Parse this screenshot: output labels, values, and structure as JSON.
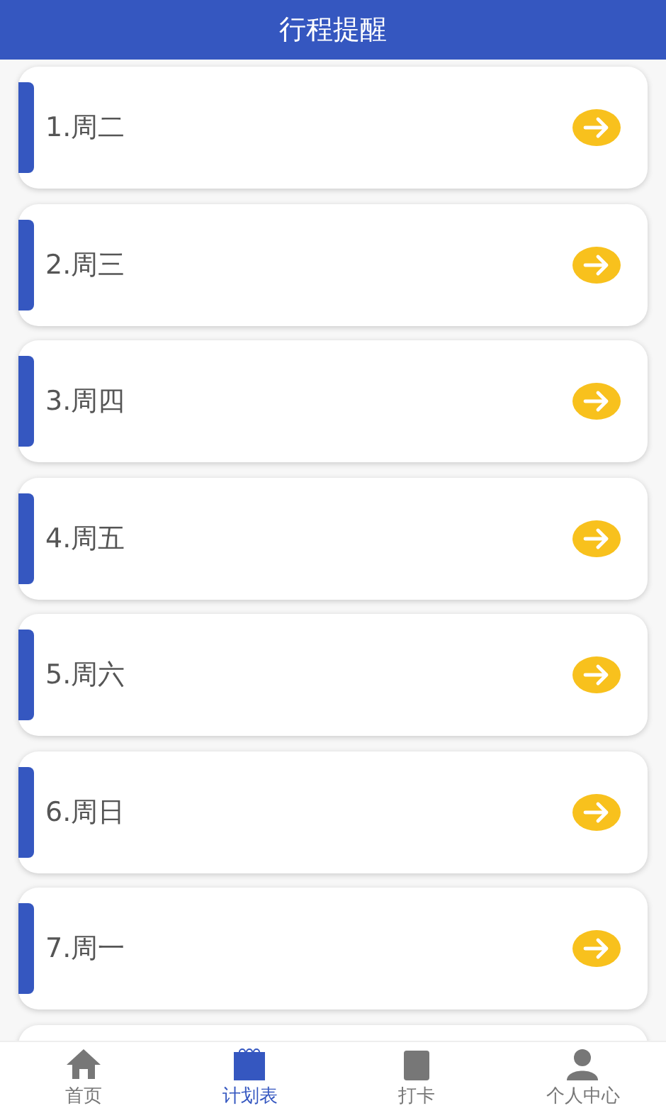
{
  "header": {
    "title": "行程提醒"
  },
  "plans": [
    {
      "label": "1.周二"
    },
    {
      "label": "2.周三"
    },
    {
      "label": "3.周四"
    },
    {
      "label": "4.周五"
    },
    {
      "label": "5.周六"
    },
    {
      "label": "6.周日"
    },
    {
      "label": "7.周一"
    }
  ],
  "tabs": [
    {
      "label": "首页",
      "kind": "home",
      "selected": false
    },
    {
      "label": "计划表",
      "kind": "calendar",
      "selected": true
    },
    {
      "label": "打卡",
      "kind": "checkin",
      "selected": false
    },
    {
      "label": "个人中心",
      "kind": "person",
      "selected": false
    }
  ]
}
